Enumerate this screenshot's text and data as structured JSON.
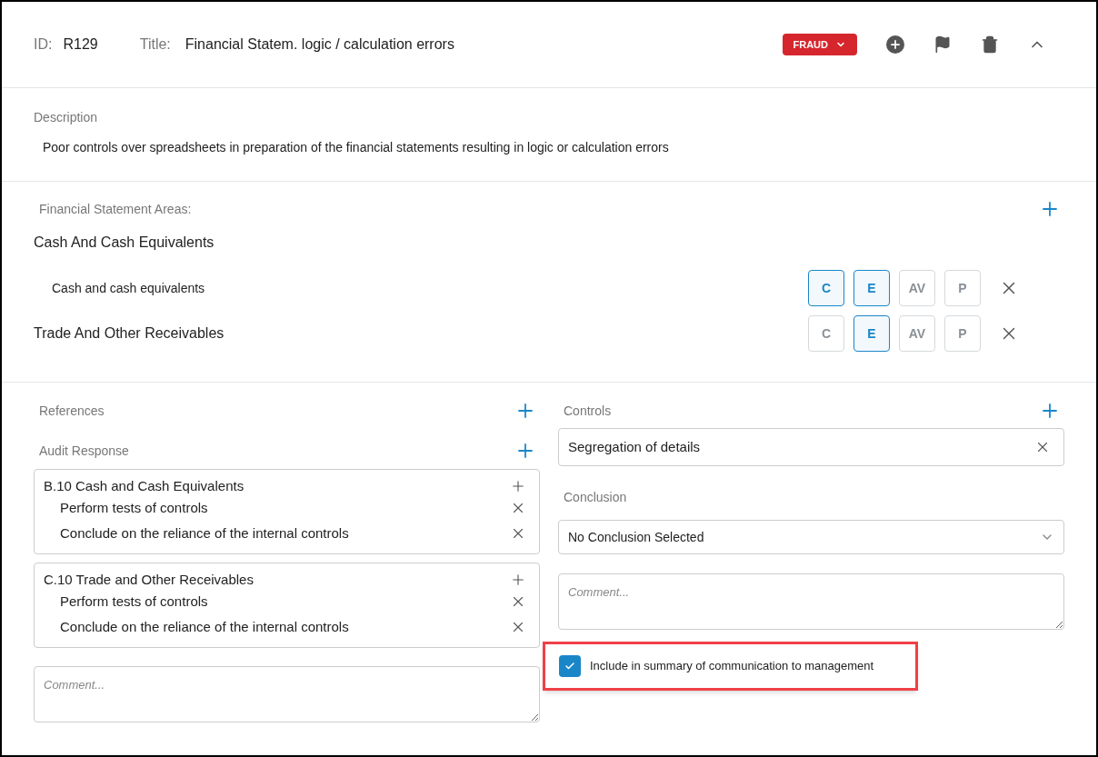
{
  "header": {
    "id_label": "ID:",
    "id": "R129",
    "title_label": "Title:",
    "title": "Financial Statem. logic / calculation errors",
    "tag": "FRAUD"
  },
  "description": {
    "label": "Description",
    "text": "Poor controls over spreadsheets in preparation of the financial statements resulting in logic or calculation errors"
  },
  "fs_areas": {
    "label": "Financial Statement Areas:",
    "rows": [
      {
        "kind": "heading",
        "label": "Cash And Cash Equivalents"
      },
      {
        "kind": "account",
        "label": "Cash and cash equivalents",
        "assertions": [
          {
            "label": "C",
            "selected": true
          },
          {
            "label": "E",
            "selected": true
          },
          {
            "label": "AV",
            "selected": false
          },
          {
            "label": "P",
            "selected": false
          }
        ]
      },
      {
        "kind": "heading",
        "label": "Trade And Other Receivables",
        "assertions": [
          {
            "label": "C",
            "selected": false
          },
          {
            "label": "E",
            "selected": true
          },
          {
            "label": "AV",
            "selected": false
          },
          {
            "label": "P",
            "selected": false
          }
        ]
      }
    ]
  },
  "references": {
    "label": "References"
  },
  "audit_response": {
    "label": "Audit Response",
    "groups": [
      {
        "title": "B.10 Cash and Cash Equivalents",
        "items": [
          "Perform tests of controls",
          "Conclude on the reliance of the internal controls"
        ]
      },
      {
        "title": "C.10 Trade and Other Receivables",
        "items": [
          "Perform tests of controls",
          "Conclude on the reliance of the internal controls"
        ]
      }
    ],
    "comment_placeholder": "Comment..."
  },
  "controls": {
    "label": "Controls",
    "items": [
      "Segregation of details"
    ]
  },
  "conclusion": {
    "label": "Conclusion",
    "value": "No Conclusion Selected",
    "comment_placeholder": "Comment..."
  },
  "include_summary": {
    "label": "Include in summary of communication to management",
    "checked": true,
    "highlighted": true
  }
}
